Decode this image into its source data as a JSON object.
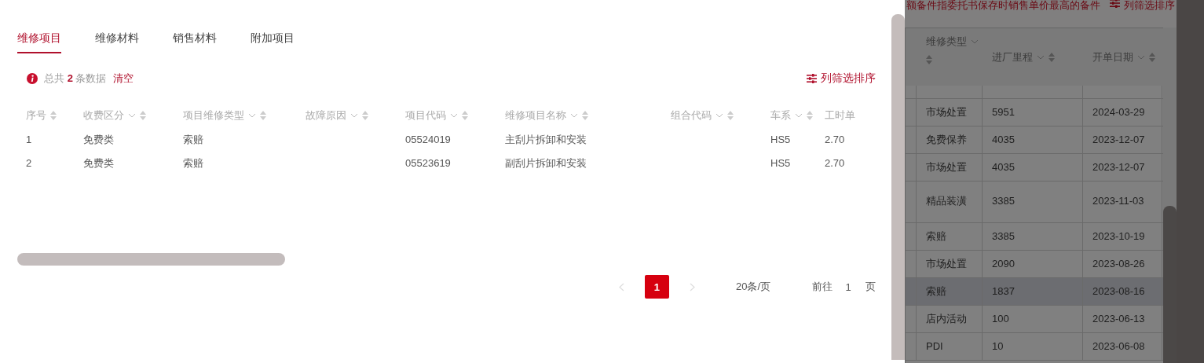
{
  "tabs": [
    {
      "label": "维修项目",
      "selected": true
    },
    {
      "label": "维修材料",
      "selected": false
    },
    {
      "label": "销售材料",
      "selected": false
    },
    {
      "label": "附加项目",
      "selected": false
    }
  ],
  "summary": {
    "text": "总共 **2** 条数据",
    "clear_link": "清空"
  },
  "column_sort_button": "列筛选排序",
  "table": {
    "columns": [
      {
        "label": "序号",
        "filter": false
      },
      {
        "label": "收费区分",
        "filter": true
      },
      {
        "label": "项目维修类型",
        "filter": true
      },
      {
        "label": "故障原因",
        "filter": true
      },
      {
        "label": "项目代码",
        "filter": true
      },
      {
        "label": "维修项目名称",
        "filter": true
      },
      {
        "label": "组合代码",
        "filter": true
      },
      {
        "label": "车系",
        "filter": true
      },
      {
        "label": "工时单",
        "filter": false
      }
    ],
    "rows": [
      [
        "1",
        "免费类",
        "索赔",
        "",
        "05524019",
        "主刮片拆卸和安装",
        "",
        "HS5",
        "2.70"
      ],
      [
        "2",
        "免费类",
        "索赔",
        "",
        "05523619",
        "副刮片拆卸和安装",
        "",
        "HS5",
        "2.70"
      ]
    ]
  },
  "pagination": {
    "pages": [
      {
        "label": "1",
        "selected": true
      }
    ],
    "page_size": "20条/页",
    "goto_label": "前往",
    "goto_value": "1",
    "page_unit": "页"
  },
  "background_panel": {
    "notice": "额备件指委托书保存时销售单价最高的备件",
    "column_sort_button": "列筛选排序",
    "columns": [
      {
        "label": "维修类型"
      },
      {
        "label": "进厂里程"
      },
      {
        "label": "开单日期"
      }
    ],
    "rows": [
      {
        "cells": [
          "市场处置",
          "5951",
          "2024-03-29"
        ],
        "highlighted": false
      },
      {
        "cells": [
          "免费保养",
          "4035",
          "2023-12-07"
        ],
        "highlighted": false
      },
      {
        "cells": [
          "市场处置",
          "4035",
          "2023-12-07"
        ],
        "highlighted": false
      },
      {
        "cells": [
          "精品装潢",
          "3385",
          "2023-11-03"
        ],
        "highlighted": false
      },
      {
        "cells": [
          "索赔",
          "3385",
          "2023-10-19"
        ],
        "highlighted": false
      },
      {
        "cells": [
          "市场处置",
          "2090",
          "2023-08-26"
        ],
        "highlighted": false
      },
      {
        "cells": [
          "索赔",
          "1837",
          "2023-08-16"
        ],
        "highlighted": true
      },
      {
        "cells": [
          "店内活动",
          "100",
          "2023-06-13"
        ],
        "highlighted": false
      },
      {
        "cells": [
          "PDI",
          "10",
          "2023-06-08"
        ],
        "highlighted": false
      }
    ]
  }
}
